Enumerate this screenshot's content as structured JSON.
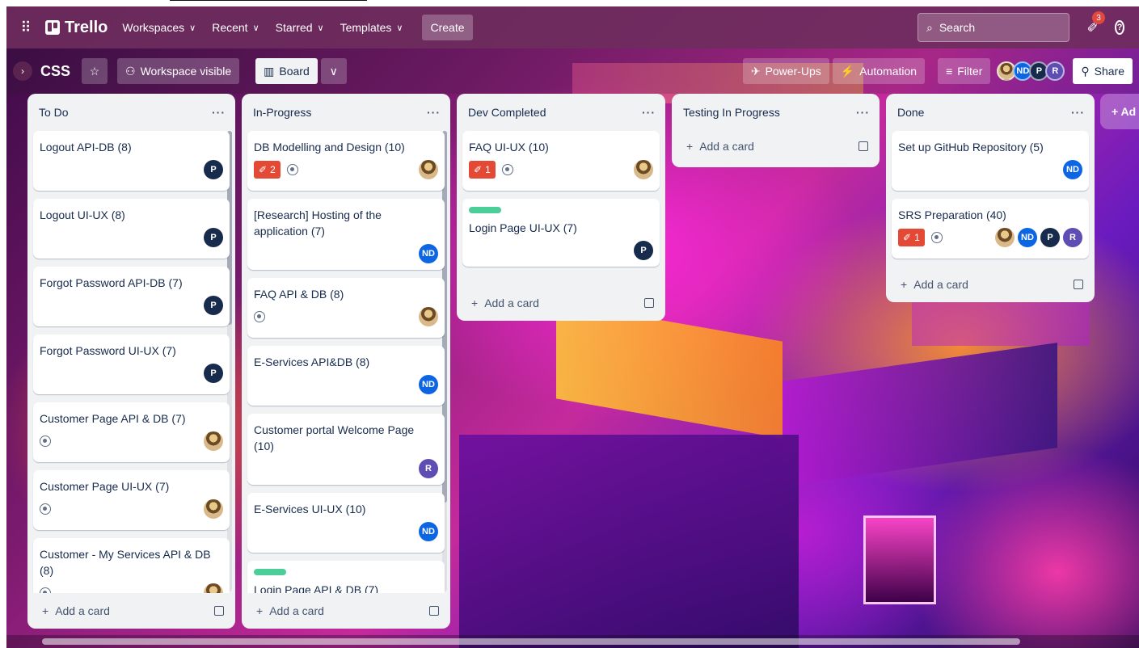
{
  "top_nav": {
    "app_name": "Trello",
    "menus": [
      {
        "label": "Workspaces"
      },
      {
        "label": "Recent"
      },
      {
        "label": "Starred"
      },
      {
        "label": "Templates"
      }
    ],
    "create_label": "Create",
    "search_placeholder": "Search",
    "notifications_count": "3"
  },
  "board_header": {
    "title": "CSS",
    "visibility_label": "Workspace visible",
    "view_label": "Board",
    "powerups_label": "Power-Ups",
    "automation_label": "Automation",
    "filter_label": "Filter",
    "share_label": "Share",
    "members": [
      "",
      "ND",
      "P",
      "R"
    ]
  },
  "add_list_label": "+ Ad",
  "lists": [
    {
      "title": "To Do",
      "add_card_label": "Add a card",
      "cards": [
        {
          "title": "Logout API-DB (8)",
          "members": [
            "P"
          ]
        },
        {
          "title": "Logout UI-UX (8)",
          "members": [
            "P"
          ]
        },
        {
          "title": "Forgot Password API-DB (7)",
          "members": [
            "P"
          ]
        },
        {
          "title": "Forgot Password UI-UX (7)",
          "members": [
            "P"
          ]
        },
        {
          "title": "Customer Page API & DB (7)",
          "watch": true,
          "members": [
            ""
          ]
        },
        {
          "title": "Customer Page UI-UX (7)",
          "watch": true,
          "members": [
            ""
          ]
        },
        {
          "title": "Customer - My Services API & DB (8)",
          "watch": true,
          "members": [
            ""
          ]
        }
      ]
    },
    {
      "title": "In-Progress",
      "add_card_label": "Add a card",
      "cards": [
        {
          "title": "DB Modelling and Design (10)",
          "badge": "2",
          "watch": true,
          "members": [
            ""
          ]
        },
        {
          "title": "[Research] Hosting of the application (7)",
          "members": [
            "ND"
          ]
        },
        {
          "title": "FAQ API & DB (8)",
          "watch": true,
          "members": [
            ""
          ]
        },
        {
          "title": "E-Services API&DB (8)",
          "members": [
            "ND"
          ]
        },
        {
          "title": "Customer portal Welcome Page (10)",
          "members": [
            "R"
          ]
        },
        {
          "title": "E-Services UI-UX (10)",
          "members": [
            "ND"
          ]
        },
        {
          "title": "Login Page API & DB (7)",
          "label_green": true,
          "members": []
        }
      ]
    },
    {
      "title": "Dev Completed",
      "add_card_label": "Add a card",
      "cards": [
        {
          "title": "FAQ UI-UX (10)",
          "badge": "1",
          "watch": true,
          "members": [
            ""
          ]
        },
        {
          "title": "Login Page UI-UX (7)",
          "label_green": true,
          "members": [
            "P"
          ]
        }
      ]
    },
    {
      "title": "Testing In Progress",
      "add_card_label": "Add a card",
      "cards": []
    },
    {
      "title": "Done",
      "add_card_label": "Add a card",
      "cards": [
        {
          "title": "Set up GitHub Repository (5)",
          "members": [
            "ND"
          ]
        },
        {
          "title": "SRS Preparation (40)",
          "badge": "1",
          "watch": true,
          "members": [
            "",
            "ND",
            "P",
            "R"
          ]
        }
      ]
    }
  ]
}
